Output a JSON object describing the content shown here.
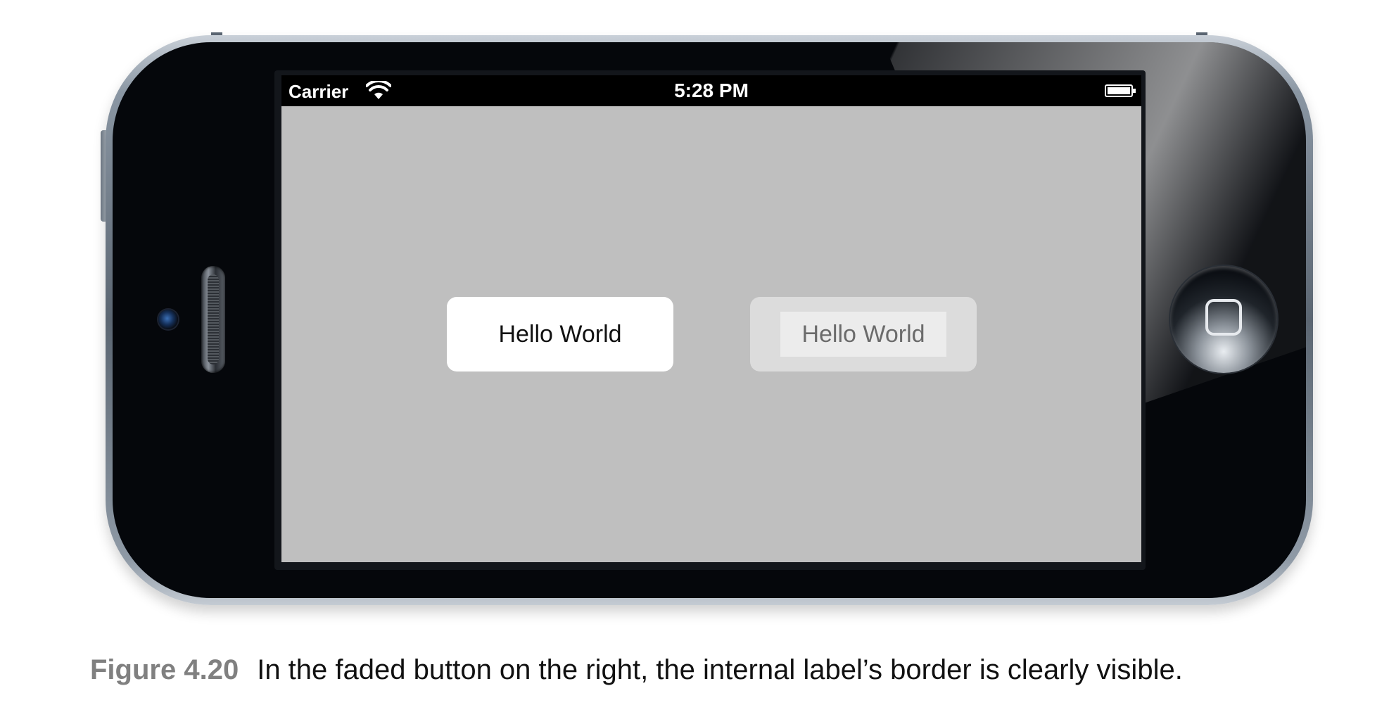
{
  "status_bar": {
    "carrier": "Carrier",
    "time": "5:28 PM",
    "wifi_icon": "wifi-icon",
    "battery_icon": "battery-icon"
  },
  "screen": {
    "background": "#bfbfbf",
    "buttons": [
      {
        "label": "Hello World",
        "state": "normal"
      },
      {
        "label": "Hello World",
        "state": "faded"
      }
    ]
  },
  "caption": {
    "label": "Figure 4.20",
    "text": "In the faded button on the right, the internal label’s border is clearly visible."
  }
}
